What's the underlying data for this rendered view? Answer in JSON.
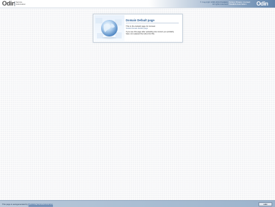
{
  "header": {
    "logo": "Odin",
    "subtitle_line1": "Service",
    "subtitle_line2": "Automation",
    "links_line1": "© Copyright 1999-2011 Parallels",
    "links_line2": "All rights reserved",
    "links2_line1": "Terms | Privacy | Contact",
    "links2_line2": "Parallels Automation",
    "logo_right": "Odin"
  },
  "box": {
    "title": "Domain Default page",
    "line1": "This is the default page for domain",
    "line2": "hosted domain default page",
    "paragraph": "If you see this page after uploading site content you probably have not replaced the index.html file."
  },
  "footer": {
    "text": "This page is autogenerated by",
    "link": "Parallels Service Automation",
    "badge": "odin"
  },
  "colors": {
    "accent": "#2d5f96",
    "footer_bg": "#9bb3cc",
    "page_bg": "#f3f4f6"
  }
}
